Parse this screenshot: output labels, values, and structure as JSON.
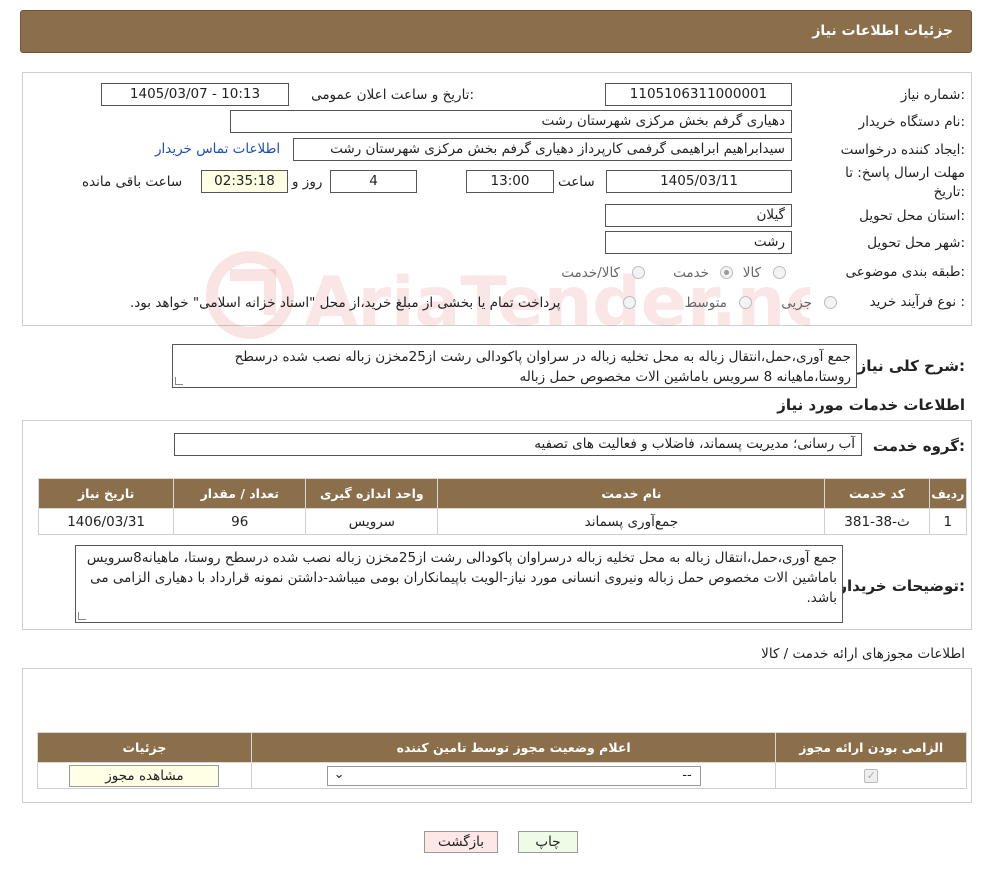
{
  "header": {
    "title": "جزئیات اطلاعات نیاز"
  },
  "form": {
    "need_number_label": "شماره نیاز:",
    "need_number": "1105106311000001",
    "announce_label": "تاریخ و ساعت اعلان عمومی:",
    "announce_value": "1405/03/07 - 10:13",
    "buyer_org_label": "نام دستگاه خریدار:",
    "buyer_org": "دهیاری گرفم بخش مرکزی شهرستان رشت",
    "requester_label": "ایجاد کننده درخواست:",
    "requester": "سیدابراهیم ابراهیمی گرفمی کارپرداز دهیاری گرفم بخش مرکزی شهرستان رشت",
    "contact_link": "اطلاعات تماس خریدار",
    "deadline_label_1": "مهلت ارسال پاسخ: تا",
    "deadline_label_2": "تاریخ:",
    "deadline_date": "1405/03/11",
    "time_label": "ساعت",
    "deadline_time": "13:00",
    "days_value": "4",
    "days_label": "روز و",
    "remaining_time": "02:35:18",
    "remaining_label": "ساعت باقی مانده",
    "province_label": "استان محل تحویل:",
    "province": "گیلان",
    "city_label": "شهر محل تحویل:",
    "city": "رشت",
    "category_label": "طبقه بندی موضوعی:",
    "category_options": [
      "کالا",
      "خدمت",
      "کالا/خدمت"
    ],
    "category_selected": "خدمت",
    "process_label": "نوع فرآیند خرید :",
    "process_options": [
      "جزیی",
      "متوسط"
    ],
    "process_note": "پرداخت تمام یا بخشی از مبلغ خرید،از محل \"اسناد خزانه اسلامی\" خواهد بود.",
    "summary_label": "شرح کلی نیاز:",
    "summary": "جمع آوری،حمل،انتقال زباله به محل تخلیه زباله در سراوان پاکودالی رشت از25مخزن زباله نصب شده درسطح روستا،ماهیانه 8 سرویس باماشین الات مخصوص حمل زباله"
  },
  "services": {
    "section_title": "اطلاعات خدمات مورد نیاز",
    "group_label": "گروه خدمت:",
    "group_value": "آب رسانی؛ مدیریت پسماند، فاضلاب و فعالیت های تصفیه",
    "columns": [
      "ردیف",
      "کد خدمت",
      "نام خدمت",
      "واحد اندازه گیری",
      "تعداد / مقدار",
      "تاریخ نیاز"
    ],
    "rows": [
      {
        "row": "1",
        "code": "ث-38-381",
        "name": "جمع‌آوری پسماند",
        "unit": "سرویس",
        "qty": "96",
        "date": "1406/03/31"
      }
    ],
    "buyer_notes_label": "توضیحات خریدار:",
    "buyer_notes": "جمع آوری،حمل،انتقال زباله به محل تخلیه زباله درسراوان پاکودالی رشت از25مخزن زباله نصب شده درسطح روستا، ماهیانه8سرویس باماشین الات مخصوص حمل زباله ونیروی انسانی مورد نیاز-الویت باپیمانکاران بومی میباشد-داشتن نمونه قرارداد با دهیاری الزامی می باشد."
  },
  "licenses": {
    "section_title": "اطلاعات مجوزهای ارائه خدمت / کالا",
    "columns": [
      "الزامی بودن ارائه مجوز",
      "اعلام وضعیت مجوز توسط تامین کننده",
      "جزئیات"
    ],
    "select_value": "--",
    "view_button": "مشاهده مجوز"
  },
  "buttons": {
    "print": "چاپ",
    "back": "بازگشت"
  },
  "watermark": {
    "text": "AriaTender.neT"
  },
  "colors": {
    "header_bg": "#8b6e4a",
    "link": "#1a4fb5",
    "back_btn": "#fde7e7",
    "print_btn": "#eefbe6"
  }
}
